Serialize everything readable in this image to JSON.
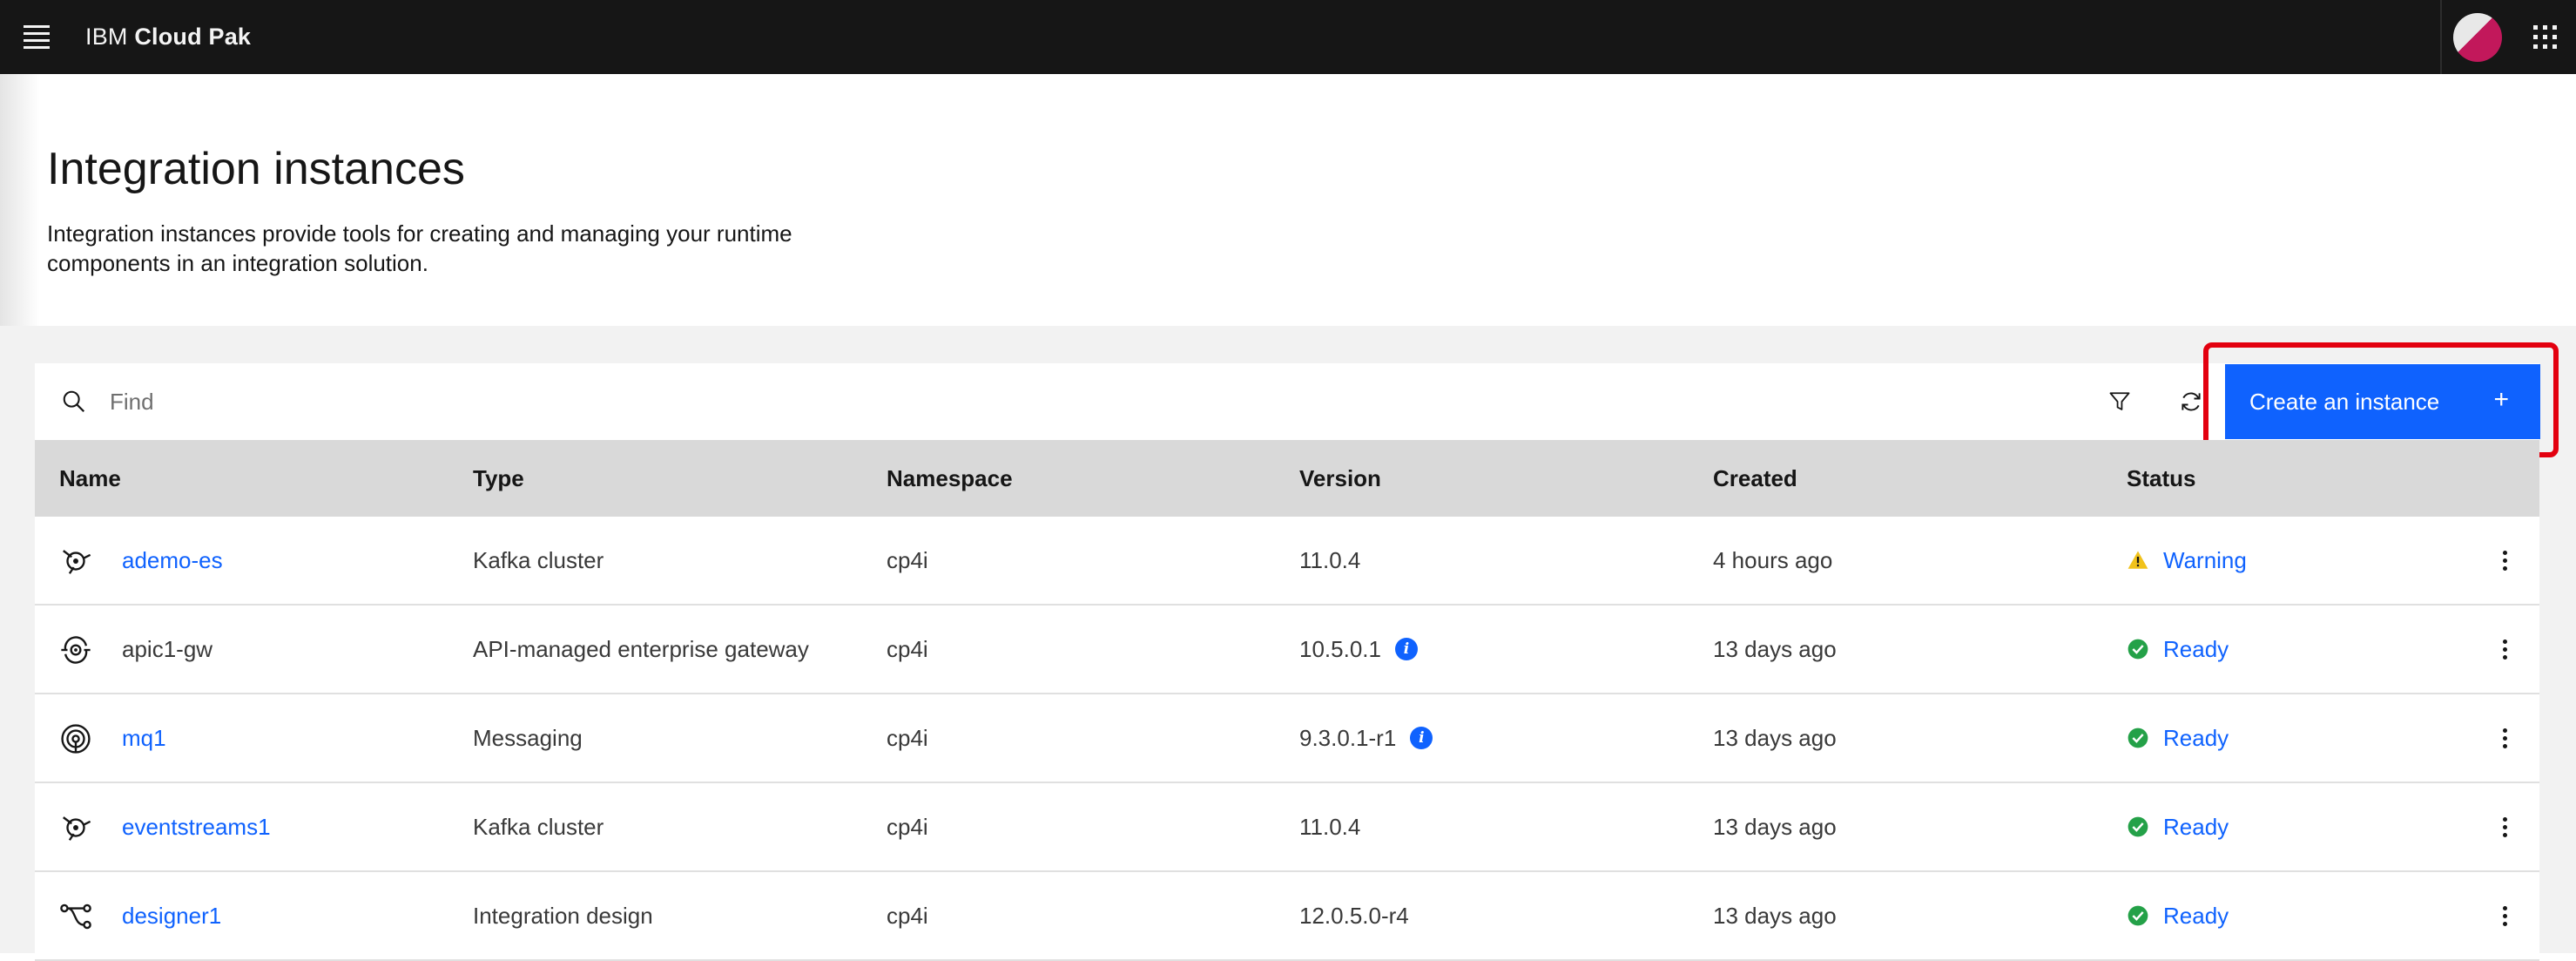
{
  "topbar": {
    "brand_prefix": "IBM",
    "brand_name": "Cloud Pak",
    "menu_icon": "hamburger-menu-icon",
    "avatar_icon": "user-avatar",
    "switcher_icon": "app-switcher-grid-icon"
  },
  "header": {
    "title": "Integration instances",
    "description": "Integration instances provide tools for creating and managing your runtime components in an integration solution."
  },
  "toolbar": {
    "search_placeholder": "Find",
    "search_value": "",
    "filter_icon": "filter-icon",
    "refresh_icon": "refresh-icon",
    "create_label": "Create an instance",
    "create_icon": "+"
  },
  "table": {
    "columns": [
      "Name",
      "Type",
      "Namespace",
      "Version",
      "Created",
      "Status"
    ],
    "rows": [
      {
        "name": "ademo-es",
        "name_is_link": true,
        "icon": "event-streams-icon",
        "type": "Kafka cluster",
        "namespace": "cp4i",
        "version": "11.0.4",
        "version_info": false,
        "created": "4 hours ago",
        "status": "Warning",
        "status_icon": "warning-icon"
      },
      {
        "name": "apic1-gw",
        "name_is_link": false,
        "icon": "api-gateway-icon",
        "type": "API-managed enterprise gateway",
        "namespace": "cp4i",
        "version": "10.5.0.1",
        "version_info": true,
        "created": "13 days ago",
        "status": "Ready",
        "status_icon": "checkmark-icon"
      },
      {
        "name": "mq1",
        "name_is_link": true,
        "icon": "messaging-icon",
        "type": "Messaging",
        "namespace": "cp4i",
        "version": "9.3.0.1-r1",
        "version_info": true,
        "created": "13 days ago",
        "status": "Ready",
        "status_icon": "checkmark-icon"
      },
      {
        "name": "eventstreams1",
        "name_is_link": true,
        "icon": "event-streams-icon",
        "type": "Kafka cluster",
        "namespace": "cp4i",
        "version": "11.0.4",
        "version_info": false,
        "created": "13 days ago",
        "status": "Ready",
        "status_icon": "checkmark-icon"
      },
      {
        "name": "designer1",
        "name_is_link": true,
        "icon": "integration-design-icon",
        "type": "Integration design",
        "namespace": "cp4i",
        "version": "12.0.5.0-r4",
        "version_info": false,
        "created": "13 days ago",
        "status": "Ready",
        "status_icon": "checkmark-icon"
      }
    ],
    "info_icon": "i"
  },
  "colors": {
    "topbar_bg": "#161616",
    "primary": "#0f62fe",
    "ready": "#24a148",
    "warning": "#f1c21b",
    "highlight_outline": "#e3000f"
  }
}
